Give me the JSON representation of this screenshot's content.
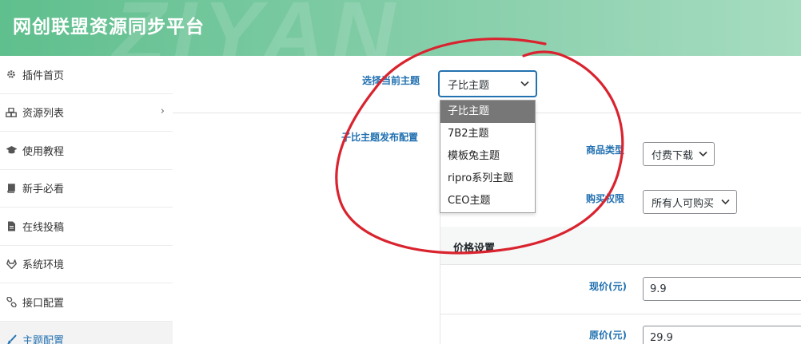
{
  "header": {
    "title": "网创联盟资源同步平台",
    "watermark": "ZIYAN"
  },
  "sidebar": {
    "items": [
      {
        "label": "插件首页",
        "icon": "gear-icon"
      },
      {
        "label": "资源列表",
        "icon": "cubes-icon",
        "arrow": "›"
      },
      {
        "label": "使用教程",
        "icon": "graduation-cap-icon"
      },
      {
        "label": "新手必看",
        "icon": "book-icon"
      },
      {
        "label": "在线投稿",
        "icon": "file-icon"
      },
      {
        "label": "系统环境",
        "icon": "gitlab-icon"
      },
      {
        "label": "接口配置",
        "icon": "link-icon"
      },
      {
        "label": "主题配置",
        "icon": "paint-brush-icon"
      }
    ]
  },
  "main": {
    "theme_label": "选择当前主题",
    "theme_select_value": "子比主题",
    "theme_options": [
      "子比主题",
      "7B2主题",
      "模板兔主题",
      "ripro系列主题",
      "CEO主题"
    ],
    "publish_label": "子比主题发布配置",
    "product_type_label": "商品类型",
    "product_type_value": "付费下载",
    "purchase_perm_label": "购买权限",
    "purchase_perm_value": "所有人可购买",
    "price_section_title": "价格设置",
    "current_price_label": "现价(元)",
    "current_price_value": "9.9",
    "original_price_label": "原价(元)",
    "original_price_value": "29.9"
  },
  "colors": {
    "header_start": "#5fbf8d",
    "header_end": "#a6dcc0",
    "link_blue": "#2271b1",
    "annotation_red": "#d9232e"
  }
}
